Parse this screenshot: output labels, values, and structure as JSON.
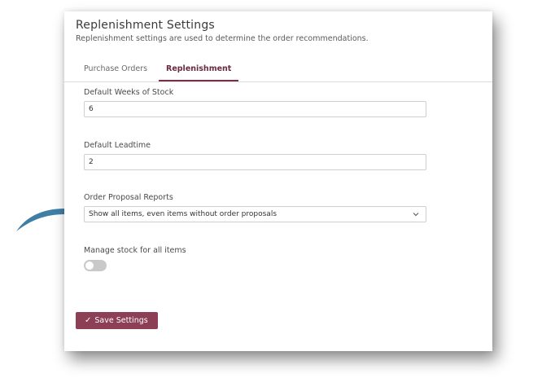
{
  "card": {
    "title": "Replenishment Settings",
    "subtitle": "Replenishment settings are used to determine the order recommendations."
  },
  "tabs": [
    {
      "label": "Purchase Orders",
      "active": false
    },
    {
      "label": "Replenishment",
      "active": true
    }
  ],
  "fields": {
    "weeks_of_stock": {
      "label": "Default Weeks of Stock",
      "value": "6"
    },
    "leadtime": {
      "label": "Default Leadtime",
      "value": "2"
    },
    "order_proposal_reports": {
      "label": "Order Proposal Reports",
      "selected": "Show all items, even items without order proposals"
    },
    "manage_stock": {
      "label": "Manage stock for all items",
      "enabled": false
    }
  },
  "save_button": {
    "label": "Save Settings",
    "icon": "check-icon"
  },
  "colors": {
    "accent": "#7a3148",
    "button": "#8c3f55",
    "arrow": "#3f7fa6",
    "toggle_off": "#c9c9c9"
  }
}
